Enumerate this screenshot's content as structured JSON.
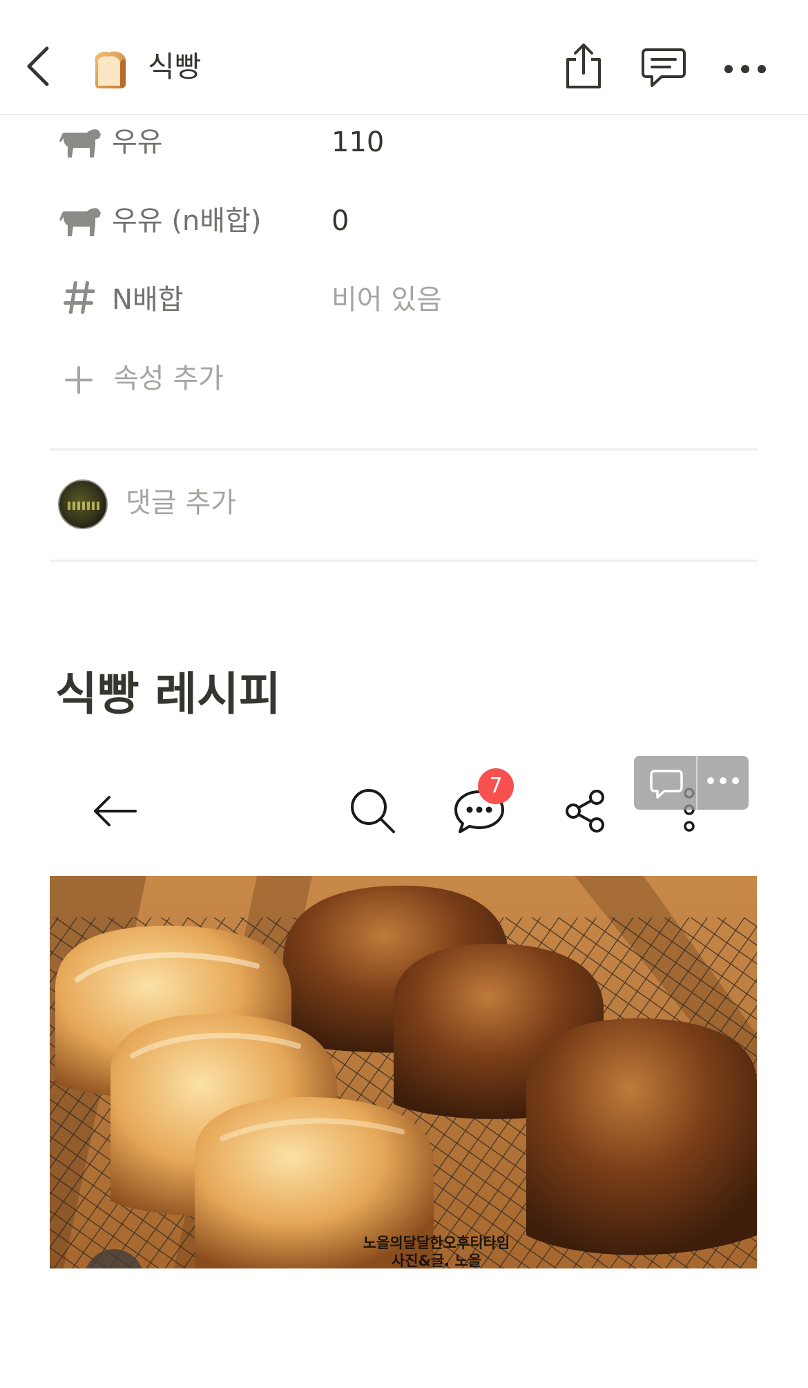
{
  "header": {
    "page_icon": "bread-emoji",
    "title": "식빵",
    "back_icon": "chevron-left-icon",
    "share_icon": "share-icon",
    "comments_icon": "comment-icon",
    "more_icon": "more-horizontal-icon"
  },
  "properties": [
    {
      "icon": "cow-icon",
      "name": "우유",
      "value": "110"
    },
    {
      "icon": "cow-icon",
      "name": "우유 (n배합)",
      "value": "0"
    },
    {
      "icon": "hash-icon",
      "name": "N배합",
      "value": "비어 있음"
    }
  ],
  "add_property": {
    "label": "속성 추가"
  },
  "comment": {
    "placeholder": "댓글 추가"
  },
  "heading": "식빵 레시피",
  "embed": {
    "comment_badge": "7",
    "photo_caption_line1": "노을의달달한오후티타임",
    "photo_caption_line2": "사진&글. 노을"
  },
  "colors": {
    "text": "#37352f",
    "muted": "#a6a5a1",
    "badge": "#f6514e"
  }
}
